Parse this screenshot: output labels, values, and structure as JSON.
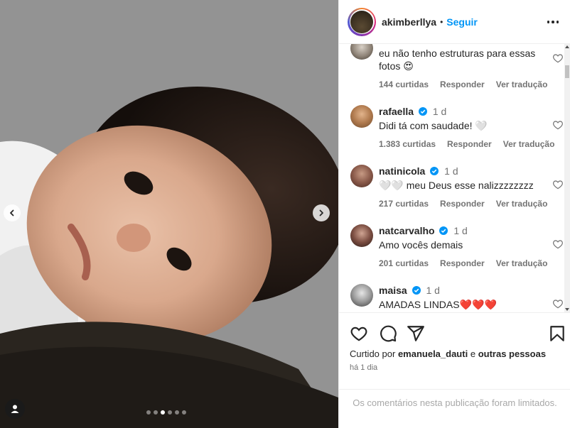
{
  "post": {
    "carousel": {
      "total_slides": 6,
      "active_index": 2
    },
    "header": {
      "username": "akimberllya",
      "separator": "•",
      "follow_label": "Seguir"
    },
    "comments": [
      {
        "username": "",
        "time": "",
        "text": "eu não tenho estruturas para essas fotos 😍",
        "likes": "144 curtidas",
        "reply": "Responder",
        "translate": "Ver tradução",
        "verified": false
      },
      {
        "username": "rafaella",
        "time": "1 d",
        "text": "Didi tá com saudade! 🤍",
        "likes": "1.383 curtidas",
        "reply": "Responder",
        "translate": "Ver tradução",
        "verified": true
      },
      {
        "username": "natinicola",
        "time": "1 d",
        "text": "🤍🤍 meu Deus esse nalizzzzzzzz",
        "likes": "217 curtidas",
        "reply": "Responder",
        "translate": "Ver tradução",
        "verified": true
      },
      {
        "username": "natcarvalho",
        "time": "1 d",
        "text": "Amo vocês demais",
        "likes": "201 curtidas",
        "reply": "Responder",
        "translate": "Ver tradução",
        "verified": true
      },
      {
        "username": "maisa",
        "time": "1 d",
        "text": "AMADAS LINDAS❤️❤️❤️",
        "likes": "",
        "reply": "",
        "translate": "",
        "verified": true
      }
    ],
    "liked_by": {
      "prefix": "Curtido por",
      "user": "emanuela_dauti",
      "connector": "e",
      "others": "outras pessoas"
    },
    "posted_time": "há 1 dia",
    "comments_limited": "Os comentários nesta publicação foram limitados."
  },
  "colors": {
    "accent": "#0095f6",
    "verified": "#0095f6",
    "text": "#262626",
    "muted": "#737373"
  },
  "icons": [
    "chevron-left-icon",
    "chevron-right-icon",
    "user-tag-icon",
    "more-icon",
    "heart-icon",
    "comment-icon",
    "share-icon",
    "bookmark-icon",
    "verified-icon"
  ]
}
